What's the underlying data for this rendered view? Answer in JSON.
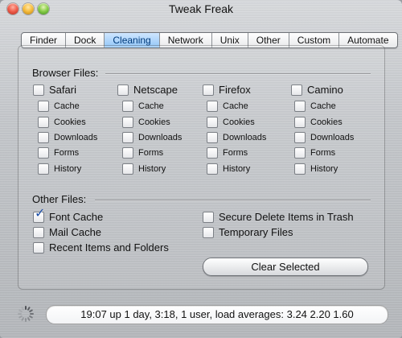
{
  "window": {
    "title": "Tweak Freak"
  },
  "tabs": [
    {
      "label": "Finder",
      "active": false
    },
    {
      "label": "Dock",
      "active": false
    },
    {
      "label": "Cleaning",
      "active": true
    },
    {
      "label": "Network",
      "active": false
    },
    {
      "label": "Unix",
      "active": false
    },
    {
      "label": "Other",
      "active": false
    },
    {
      "label": "Custom",
      "active": false
    },
    {
      "label": "Automate",
      "active": false
    }
  ],
  "browser_files": {
    "heading": "Browser Files:",
    "browsers": [
      {
        "name": "Safari",
        "checked": false,
        "items": [
          {
            "label": "Cache",
            "checked": false
          },
          {
            "label": "Cookies",
            "checked": false
          },
          {
            "label": "Downloads",
            "checked": false
          },
          {
            "label": "Forms",
            "checked": false
          },
          {
            "label": "History",
            "checked": false
          }
        ]
      },
      {
        "name": "Netscape",
        "checked": false,
        "items": [
          {
            "label": "Cache",
            "checked": false
          },
          {
            "label": "Cookies",
            "checked": false
          },
          {
            "label": "Downloads",
            "checked": false
          },
          {
            "label": "Forms",
            "checked": false
          },
          {
            "label": "History",
            "checked": false
          }
        ]
      },
      {
        "name": "Firefox",
        "checked": false,
        "items": [
          {
            "label": "Cache",
            "checked": false
          },
          {
            "label": "Cookies",
            "checked": false
          },
          {
            "label": "Downloads",
            "checked": false
          },
          {
            "label": "Forms",
            "checked": false
          },
          {
            "label": "History",
            "checked": false
          }
        ]
      },
      {
        "name": "Camino",
        "checked": false,
        "items": [
          {
            "label": "Cache",
            "checked": false
          },
          {
            "label": "Cookies",
            "checked": false
          },
          {
            "label": "Downloads",
            "checked": false
          },
          {
            "label": "Forms",
            "checked": false
          },
          {
            "label": "History",
            "checked": false
          }
        ]
      }
    ]
  },
  "other_files": {
    "heading": "Other Files:",
    "left": [
      {
        "label": "Font Cache",
        "checked": true
      },
      {
        "label": "Mail Cache",
        "checked": false
      },
      {
        "label": "Recent Items and Folders",
        "checked": false
      }
    ],
    "right": [
      {
        "label": "Secure Delete Items in Trash",
        "checked": false
      },
      {
        "label": "Temporary Files",
        "checked": false
      }
    ]
  },
  "actions": {
    "clear_selected_label": "Clear Selected"
  },
  "status": {
    "text": "19:07  up 1 day,  3:18, 1 user, load averages: 3.24 2.20 1.60"
  },
  "icons": {
    "close": "close-button-icon",
    "minimize": "minimize-button-icon",
    "zoom": "zoom-button-icon",
    "spinner": "activity-spinner-icon"
  }
}
